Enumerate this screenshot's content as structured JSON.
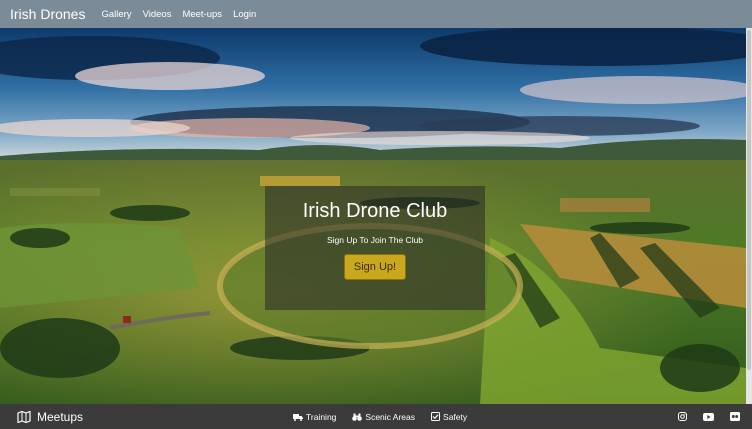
{
  "navbar": {
    "brand": "Irish Drones",
    "links": [
      "Gallery",
      "Videos",
      "Meet-ups",
      "Login"
    ]
  },
  "hero": {
    "title": "Irish Drone Club",
    "subtitle": "Sign Up To Join The Club",
    "button_label": "Sign Up!"
  },
  "footer": {
    "brand": "Meetups",
    "brand_icon": "map-icon",
    "links": [
      {
        "label": "Training",
        "icon": "truck-icon"
      },
      {
        "label": "Scenic Areas",
        "icon": "binoculars-icon"
      },
      {
        "label": "Safety",
        "icon": "check-square-icon"
      }
    ],
    "social": [
      "instagram-icon",
      "youtube-icon",
      "flickr-icon"
    ]
  },
  "colors": {
    "navbar": "#7b8c98",
    "footer": "#3b3b3b",
    "button": "#c9a81e"
  }
}
